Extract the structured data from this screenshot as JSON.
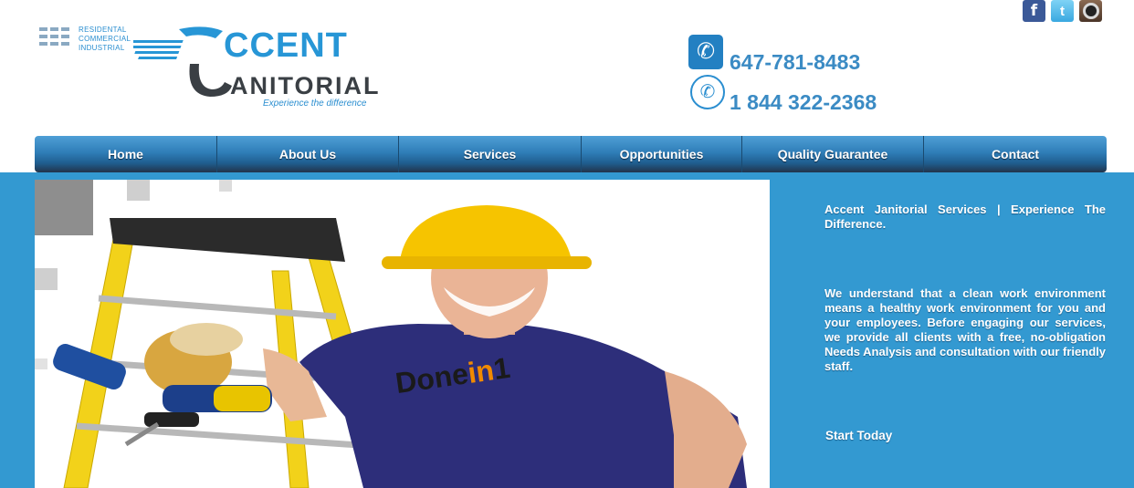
{
  "logo": {
    "tags": [
      "RESIDENTAL",
      "COMMERCIAL",
      "INDUSTRIAL"
    ],
    "word1": "CCENT",
    "word2": "ANITORIAL",
    "tagline": "Experience the difference"
  },
  "social": [
    {
      "name": "facebook-icon",
      "glyph": "f"
    },
    {
      "name": "twitter-icon",
      "glyph": "t"
    },
    {
      "name": "instagram-icon",
      "glyph": ""
    }
  ],
  "contact": {
    "phone1": "647-781-8483",
    "phone2": "1 844 322-2368"
  },
  "nav": {
    "items": [
      "Home",
      "About Us",
      "Services",
      "Opportunities",
      "Quality Guarantee",
      "Contact"
    ]
  },
  "hero": {
    "shirt_text_a": "Done",
    "shirt_text_b": "in",
    "shirt_text_c": "1"
  },
  "sidebar": {
    "heading": "Accent Janitorial Services | Experience The Difference.",
    "body": "We understand that a clean work environment means a healthy work environment for you and your employees. Before engaging our services, we provide all clients with a free, no-obligation Needs Analysis and consultation with our friendly staff.",
    "cta": "Start Today"
  },
  "colors": {
    "main_bg": "#3399d1",
    "nav_top": "#4f9fd6",
    "nav_bottom": "#22344a",
    "phone_text": "#3b8bc4",
    "logo_blue": "#2796d6"
  }
}
